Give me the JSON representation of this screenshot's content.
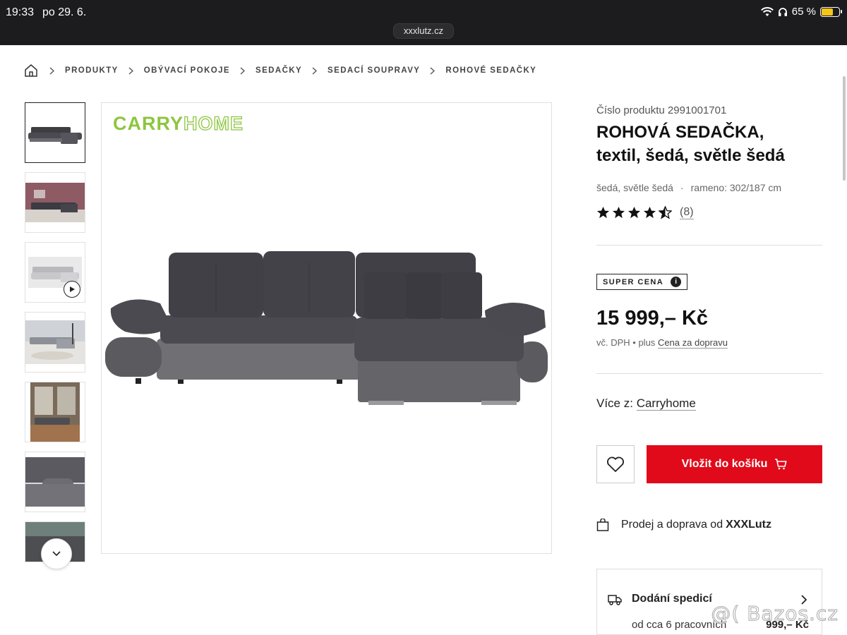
{
  "statusbar": {
    "time": "19:33",
    "date": "po 29. 6.",
    "battery": "65 %",
    "url": "xxxlutz.cz"
  },
  "breadcrumb": [
    "PRODUKTY",
    "OBÝVACÍ POKOJE",
    "SEDAČKY",
    "SEDACÍ SOUPRAVY",
    "ROHOVÉ SEDAČKY"
  ],
  "brand": {
    "part1": "CARRY",
    "part2": "HOME"
  },
  "product": {
    "number": "Číslo produktu 2991001701",
    "title_bold": "ROHOVÁ",
    "title_rest": " SEDAČKA,",
    "title_line2": "textil, šedá, světle šedá",
    "color": "šedá, světle šedá",
    "arm": "rameno: 302/187 cm",
    "rating_count": "(8)",
    "rating_value": 4.5,
    "badge": "SUPER CENA",
    "badge_info": "i",
    "price": "15 999,– Kč",
    "vat": "vč. DPH",
    "plus": "plus",
    "shipping_link": "Cena za dopravu",
    "more_label": "Více z:",
    "more_brand": "Carryhome",
    "cart_label": "Vložit do košíku",
    "seller_text": "Prodej a doprava od",
    "seller_name": "XXXLutz"
  },
  "delivery": {
    "title": "Dodání spedicí",
    "subtitle": "od cca 6 pracovních",
    "price": "999,– Kč"
  },
  "watermark": "@( Bazos.cz"
}
